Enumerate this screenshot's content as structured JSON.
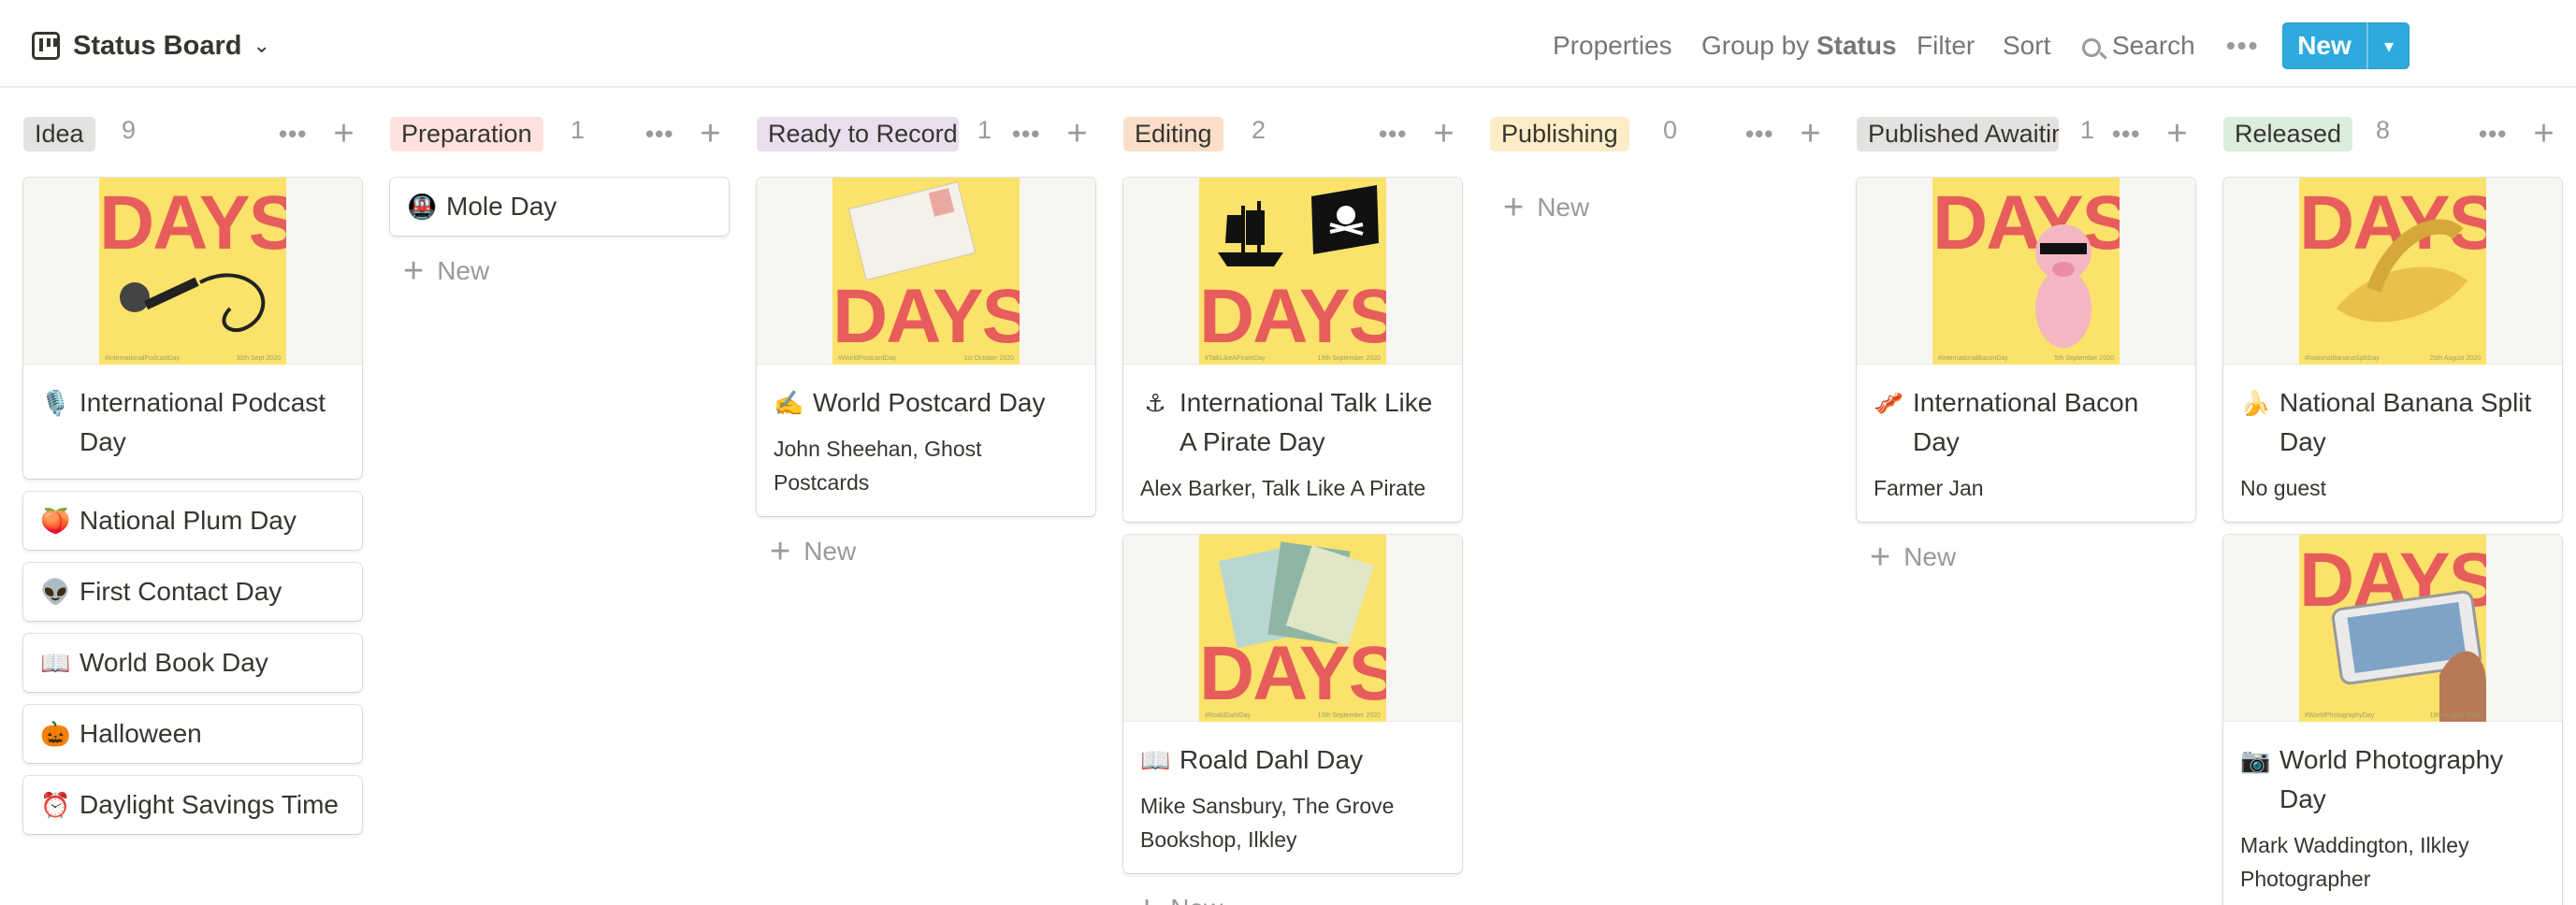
{
  "header": {
    "title": "Status Board",
    "properties": "Properties",
    "group_by_label": "Group by",
    "group_by_value": "Status",
    "filter": "Filter",
    "sort": "Sort",
    "search": "Search",
    "more": "•••",
    "new_button": "New",
    "new_dropdown": "▾"
  },
  "new_card_label": "New",
  "columns": [
    {
      "name": "Idea",
      "count": "9",
      "color": "#e3e2e0",
      "cards": [
        {
          "emoji": "🎙️",
          "title": "International Podcast Day",
          "poster": "#InternationalPodcastDay",
          "poster_date": "30th Sept 2020"
        },
        {
          "emoji": "🍑",
          "title": "National Plum Day"
        },
        {
          "emoji": "👽",
          "title": "First Contact Day"
        },
        {
          "emoji": "📖",
          "title": "World Book Day"
        },
        {
          "emoji": "🎃",
          "title": "Halloween"
        },
        {
          "emoji": "⏰",
          "title": "Daylight Savings Time"
        }
      ]
    },
    {
      "name": "Preparation",
      "count": "1",
      "color": "#ffe2dd",
      "cards": [
        {
          "emoji": "🚇",
          "title": "Mole Day"
        }
      ]
    },
    {
      "name": "Ready to Record",
      "count": "1",
      "color": "#e8deee",
      "cards": [
        {
          "emoji": "✍️",
          "title": "World Postcard Day",
          "subtitle": "John Sheehan, Ghost Postcards",
          "poster": "#WorldPostcardDay",
          "poster_date": "1st October 2020"
        }
      ]
    },
    {
      "name": "Editing",
      "count": "2",
      "color": "#fadec9",
      "cards": [
        {
          "emoji": "⚓",
          "title": "International Talk Like A Pirate Day",
          "subtitle": "Alex Barker, Talk Like A Pirate",
          "poster": "#TalkLikeAPirateDay",
          "poster_date": "19th September 2020"
        },
        {
          "emoji": "📖",
          "title": "Roald Dahl Day",
          "subtitle": "Mike Sansbury, The Grove Bookshop, Ilkley",
          "poster": "#RoaldDahlDay",
          "poster_date": "13th September 2020"
        }
      ]
    },
    {
      "name": "Publishing",
      "count": "0",
      "color": "#fdecc8",
      "cards": []
    },
    {
      "name": "Published Awaiting",
      "count": "1",
      "color": "#e3e2e0",
      "cards": [
        {
          "emoji": "🥓",
          "title": "International Bacon Day",
          "subtitle": "Farmer Jan",
          "poster": "#InternationalBaconDay",
          "poster_date": "5th September 2020"
        }
      ]
    },
    {
      "name": "Released",
      "count": "8",
      "color": "#dbeddb",
      "cards": [
        {
          "emoji": "🍌",
          "title": "National Banana Split Day",
          "subtitle": "No guest",
          "poster": "#NationalBananaSplitDay",
          "poster_date": "25th August 2020"
        },
        {
          "emoji": "📷",
          "title": "World Photography Day",
          "subtitle": "Mark Waddington, Ilkley Photographer",
          "poster": "#WorldPhotographyDay",
          "poster_date": "19th August 2020"
        }
      ]
    }
  ],
  "poster_word": "DAYS",
  "colors": {
    "accent": "#2eaadc",
    "poster_bg": "#fbe26b",
    "poster_text": "#e65d5b",
    "muted": "#9b9a97"
  }
}
